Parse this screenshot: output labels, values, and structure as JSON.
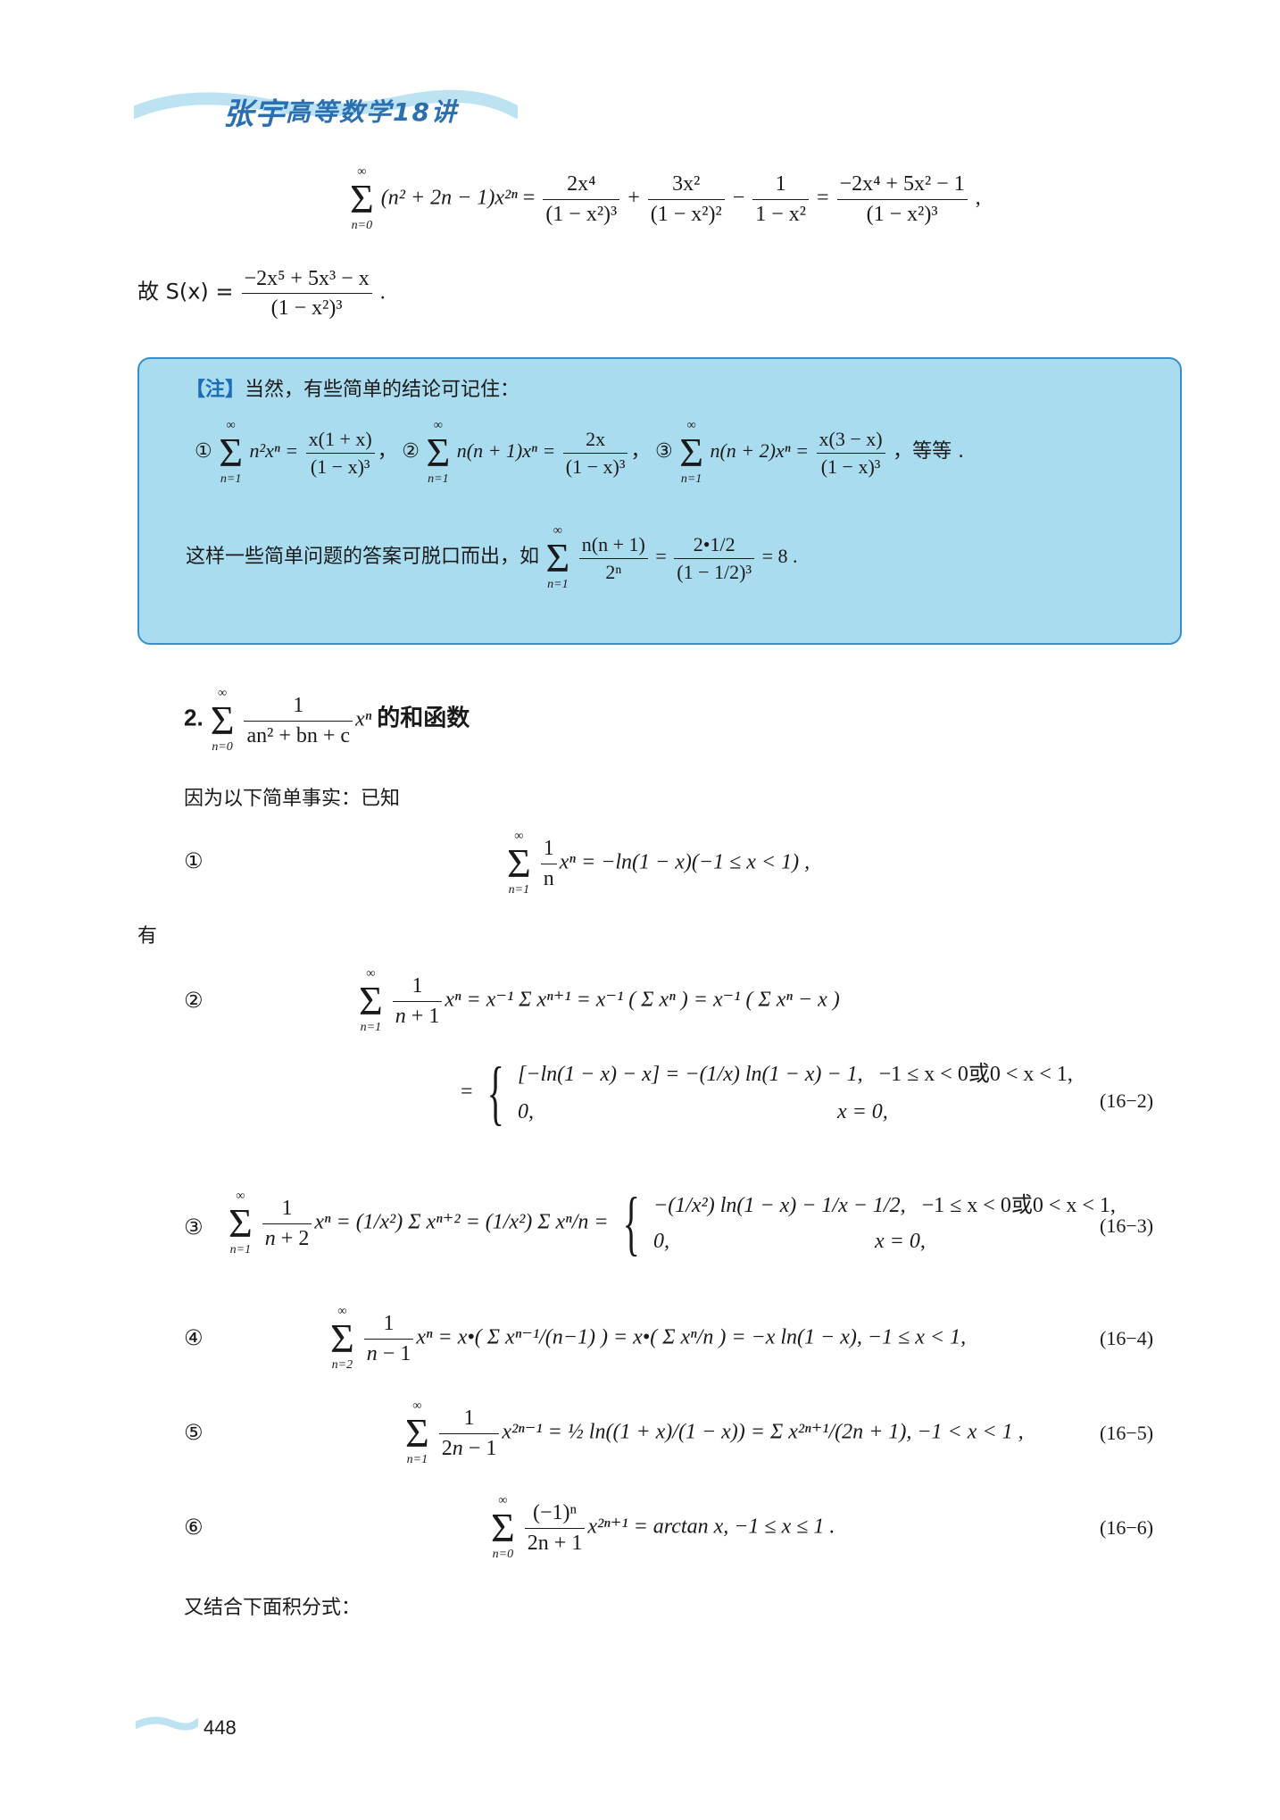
{
  "header": {
    "logo": "张宇",
    "title": "高等数学18讲"
  },
  "eq_top": {
    "lhs_factor": "(n² + 2n − 1)x²ⁿ",
    "t1_num": "2x⁴",
    "t1_den": "(1 − x²)³",
    "t2_num": "3x²",
    "t2_den": "(1 − x²)²",
    "t3_num": "1",
    "t3_den": "1 − x²",
    "res_num": "−2x⁴ + 5x² − 1",
    "res_den": "(1 − x²)³",
    "tail": ","
  },
  "conclusion": {
    "prefix": "故 S(x) =",
    "num": "−2x⁵ + 5x³ − x",
    "den": "(1 − x²)³",
    "tail": "."
  },
  "note": {
    "tag": "【注】",
    "intro": "当然，有些简单的结论可记住：",
    "f1_label": "①",
    "f1_body": "n²xⁿ =",
    "f1_num": "x(1 + x)",
    "f1_den": "(1 − x)³",
    "f2_label": "②",
    "f2_body": "n(n + 1)xⁿ =",
    "f2_num": "2x",
    "f2_den": "(1 − x)³",
    "f3_label": "③",
    "f3_body": "n(n + 2)xⁿ =",
    "f3_num": "x(3 − x)",
    "f3_den": "(1 − x)³",
    "etc": "，等等 .",
    "sentence": "这样一些简单问题的答案可脱口而出，如",
    "ex_num": "n(n + 1)",
    "ex_den": "2ⁿ",
    "ex_rhs_num": "2•1/2",
    "ex_rhs_den": "(1 − 1/2)³",
    "ex_result": "= 8 ."
  },
  "section2": {
    "number": "2.",
    "sum_num": "1",
    "sum_den": "an² + bn + c",
    "sum_tail": "xⁿ",
    "title": "的和函数"
  },
  "intro_text": "因为以下简单事实：已知",
  "you_text": "有",
  "fact1": {
    "label": "①",
    "body": "xⁿ = −ln(1 − x)(−1 ≤ x < 1) ,",
    "frac_num": "1",
    "frac_den": "n"
  },
  "eq2": {
    "label": "②",
    "line1": "xⁿ = x⁻¹ Σ xⁿ⁺¹ = x⁻¹ ( Σ xⁿ ) = x⁻¹ ( Σ xⁿ − x )",
    "case1_expr": "[−ln(1 − x) − x] = −(1/x) ln(1 − x) − 1,",
    "case1_cond": "−1 ≤ x < 0或0 < x < 1,",
    "case2_expr": "0,",
    "case2_cond": "x = 0,",
    "number": "(16−2)"
  },
  "eq3": {
    "label": "③",
    "lhs": "xⁿ = (1/x²) Σ xⁿ⁺² = (1/x²) Σ xⁿ/n =",
    "case1_expr": "−(1/x²) ln(1 − x) − 1/x − 1/2,",
    "case1_cond": "−1 ≤ x < 0或0 < x < 1,",
    "case2_expr": "0,",
    "case2_cond": "x = 0,",
    "number": "(16−3)"
  },
  "eq4": {
    "label": "④",
    "body": "xⁿ = x•( Σ xⁿ⁻¹/(n−1) ) = x•( Σ xⁿ/n ) = −x ln(1 − x), −1 ≤ x < 1,",
    "number": "(16−4)"
  },
  "eq5": {
    "label": "⑤",
    "body": "x²ⁿ⁻¹ = ½ ln((1 + x)/(1 − x)) = Σ x²ⁿ⁺¹/(2n + 1), −1 < x < 1 ,",
    "number": "(16−5)"
  },
  "eq6": {
    "label": "⑥",
    "body": "x²ⁿ⁺¹ = arctan x, −1 ≤ x ≤ 1 .",
    "num": "(−1)ⁿ",
    "den": "2n + 1",
    "number": "(16−6)"
  },
  "closing_text": "又结合下面积分式：",
  "page_number": "448",
  "colors": {
    "accent": "#2a6fb0",
    "note_bg": "#a9dcef",
    "note_border": "#3a8fc7"
  }
}
